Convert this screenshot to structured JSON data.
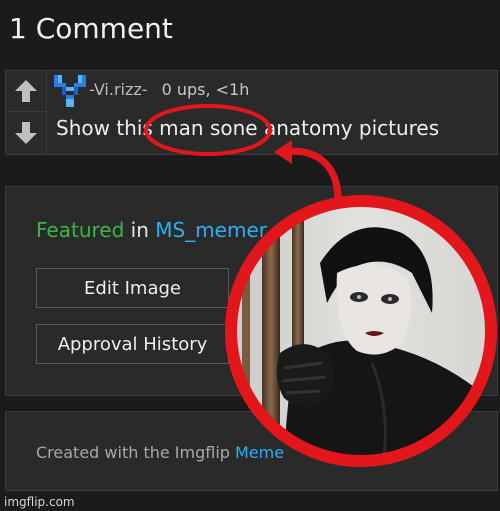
{
  "heading": "1 Comment",
  "comment": {
    "username": "-Vi.rizz-",
    "meta": "0 ups, <1h",
    "text": "Show this man sone anatomy pictures"
  },
  "panel": {
    "featured_word": "Featured",
    "in_word": "in",
    "stream": "MS_memer",
    "edit_button": "Edit Image",
    "history_button": "Approval History"
  },
  "footer": {
    "created_text": "Created with the Imgflip",
    "link_text": "Meme"
  },
  "watermark": "imgflip.com",
  "colors": {
    "background": "#1b1b1b",
    "panel": "#2a2a2a",
    "featured_green": "#3cb44b",
    "link_blue": "#2ab0f0",
    "annotation_red": "#e3161c"
  },
  "icons": [
    "arrow-up-icon",
    "arrow-down-icon",
    "avatar-icon"
  ]
}
